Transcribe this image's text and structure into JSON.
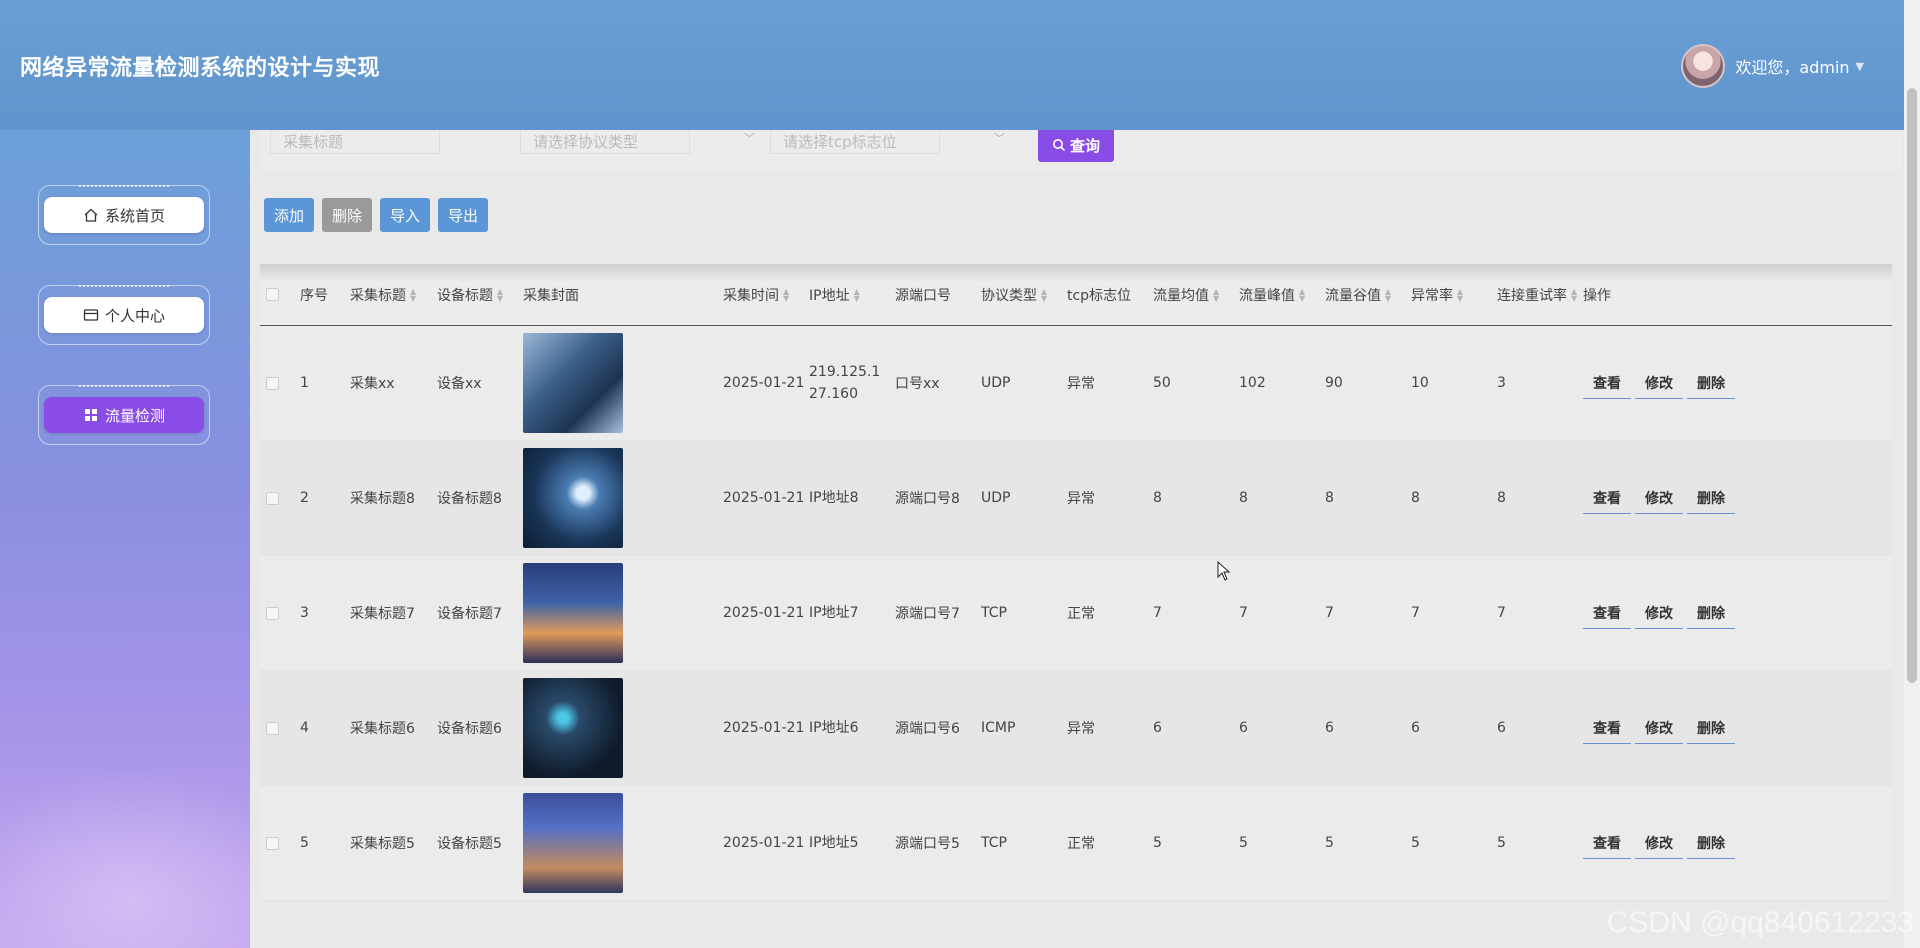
{
  "header": {
    "title": "网络异常流量检测系统的设计与实现",
    "welcome": "欢迎您，admin",
    "caret": "▼"
  },
  "sidebar": {
    "items": [
      {
        "label": "系统首页",
        "icon": "home-icon",
        "active": false
      },
      {
        "label": "个人中心",
        "icon": "wallet-icon",
        "active": false
      },
      {
        "label": "流量检测",
        "icon": "grid-icon",
        "active": true
      }
    ]
  },
  "search": {
    "title_placeholder": "采集标题",
    "protocol_placeholder": "请选择协议类型",
    "tcp_placeholder": "请选择tcp标志位",
    "query_label": "查询"
  },
  "toolbar": {
    "add_label": "添加",
    "delete_label": "删除",
    "import_label": "导入",
    "export_label": "导出"
  },
  "table": {
    "headers": [
      "序号",
      "采集标题",
      "设备标题",
      "采集封面",
      "采集时间",
      "IP地址",
      "源端口号",
      "协议类型",
      "tcp标志位",
      "流量均值",
      "流量峰值",
      "流量谷值",
      "异常率",
      "连接重试率",
      "操作"
    ],
    "actions": {
      "view": "查看",
      "edit": "修改",
      "delete": "删除"
    },
    "rows": [
      {
        "no": "1",
        "title": "采集xx",
        "device": "设备xx",
        "time": "2025-01-21",
        "ip": "219.125.127.160",
        "port": "口号xx",
        "protocol": "UDP",
        "tcp": "异常",
        "avg": "50",
        "peak": "102",
        "valley": "90",
        "anomaly": "10",
        "retry": "3"
      },
      {
        "no": "2",
        "title": "采集标题8",
        "device": "设备标题8",
        "time": "2025-01-21",
        "ip": "IP地址8",
        "port": "源端口号8",
        "protocol": "UDP",
        "tcp": "异常",
        "avg": "8",
        "peak": "8",
        "valley": "8",
        "anomaly": "8",
        "retry": "8"
      },
      {
        "no": "3",
        "title": "采集标题7",
        "device": "设备标题7",
        "time": "2025-01-21",
        "ip": "IP地址7",
        "port": "源端口号7",
        "protocol": "TCP",
        "tcp": "正常",
        "avg": "7",
        "peak": "7",
        "valley": "7",
        "anomaly": "7",
        "retry": "7"
      },
      {
        "no": "4",
        "title": "采集标题6",
        "device": "设备标题6",
        "time": "2025-01-21",
        "ip": "IP地址6",
        "port": "源端口号6",
        "protocol": "ICMP",
        "tcp": "异常",
        "avg": "6",
        "peak": "6",
        "valley": "6",
        "anomaly": "6",
        "retry": "6"
      },
      {
        "no": "5",
        "title": "采集标题5",
        "device": "设备标题5",
        "time": "2025-01-21",
        "ip": "IP地址5",
        "port": "源端口号5",
        "protocol": "TCP",
        "tcp": "正常",
        "avg": "5",
        "peak": "5",
        "valley": "5",
        "anomaly": "5",
        "retry": "5"
      }
    ]
  },
  "watermark": "CSDN @qq840612233"
}
